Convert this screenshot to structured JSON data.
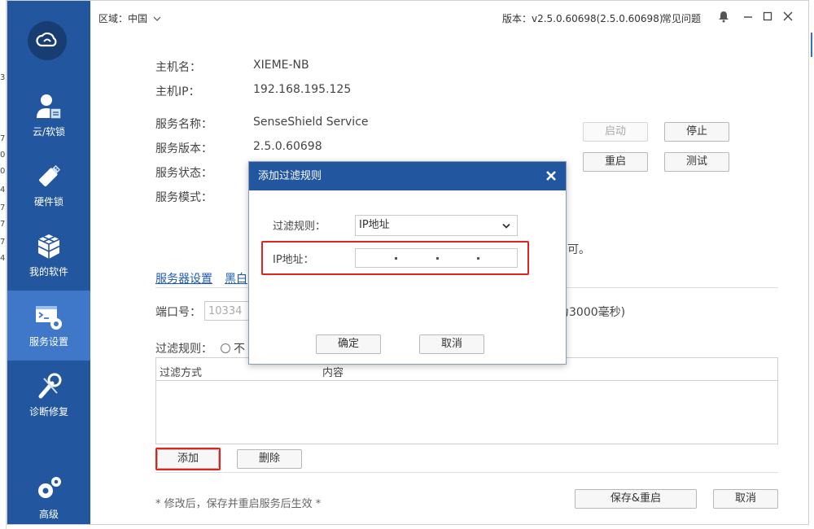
{
  "window": {
    "region_label": "区域：中国",
    "version_text": "版本：v2.5.0.60698(2.5.0.60698)",
    "faq_label": "常见问题"
  },
  "sidebar": {
    "items": [
      {
        "label": "云/软锁",
        "icon": "user-lock-icon"
      },
      {
        "label": "硬件锁",
        "icon": "usb-dongle-icon"
      },
      {
        "label": "我的软件",
        "icon": "cubes-icon"
      },
      {
        "label": "服务设置",
        "icon": "terminal-gear-icon",
        "active": true
      },
      {
        "label": "诊断修复",
        "icon": "wrench-icon"
      },
      {
        "label": "高级",
        "icon": "gears-icon"
      }
    ]
  },
  "host": {
    "name_label": "主机名：",
    "name_value": "XIEME-NB",
    "ip_label": "主机IP：",
    "ip_value": "192.168.195.125"
  },
  "service": {
    "name_label": "服务名称：",
    "name_value": "SenseShield Service",
    "version_label": "服务版本：",
    "version_value": "2.5.0.60698",
    "status_label": "服务状态：",
    "mode_label": "服务模式：",
    "start_label": "启动",
    "stop_label": "停止",
    "restart_label": "重启",
    "test_label": "测试",
    "partial_note": "可。"
  },
  "tabs": {
    "server_settings": "服务器设置",
    "blackwhite_partial": "黑白"
  },
  "port": {
    "label": "端口号：",
    "value": "10334",
    "partial_note": "为3000毫秒)"
  },
  "filter": {
    "label": "过滤规则：",
    "radio_partial": "不",
    "col_method": "过滤方式",
    "col_content": "内容",
    "add_label": "添加",
    "delete_label": "删除"
  },
  "footer": {
    "note": "* 修改后，保存并重启服务后生效 *",
    "save_restart_label": "保存&重启",
    "cancel_label": "取消"
  },
  "dialog": {
    "title": "添加过滤规则",
    "rule_label": "过滤规则：",
    "rule_value": "IP地址",
    "ip_label": "IP地址：",
    "ok_label": "确定",
    "cancel_label": "取消"
  },
  "colors": {
    "sidebar": "#22579f",
    "sidebar_active": "#3f78c9",
    "highlight": "#e0231d",
    "link": "#1e5bb0"
  }
}
